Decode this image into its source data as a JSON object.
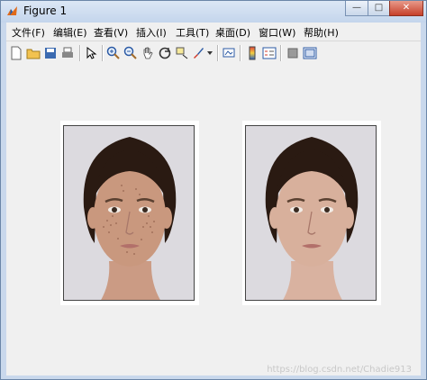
{
  "window": {
    "title": "Figure 1"
  },
  "window_controls": {
    "minimize": "—",
    "maximize": "□",
    "close": "✕"
  },
  "menubar": {
    "items": [
      "文件(F)",
      "编辑(E)",
      "查看(V)",
      "插入(I)",
      "工具(T)",
      "桌面(D)",
      "窗口(W)",
      "帮助(H)"
    ]
  },
  "toolbar": {
    "icons": [
      "new-figure-icon",
      "open-file-icon",
      "save-icon",
      "print-icon",
      "pointer-icon",
      "zoom-in-icon",
      "zoom-out-icon",
      "pan-hand-icon",
      "rotate-3d-icon",
      "data-cursor-icon",
      "brush-icon",
      "link-plot-icon",
      "colorbar-icon",
      "legend-icon",
      "hide-plot-tools-icon",
      "show-plot-tools-icon"
    ]
  },
  "figure": {
    "images": [
      {
        "name": "original face photo",
        "skin": "#c9987e",
        "blemishes": true
      },
      {
        "name": "smoothed face photo",
        "skin": "#d8b09c",
        "blemishes": false
      }
    ],
    "watermark": "https://blog.csdn.net/Chadie913"
  }
}
